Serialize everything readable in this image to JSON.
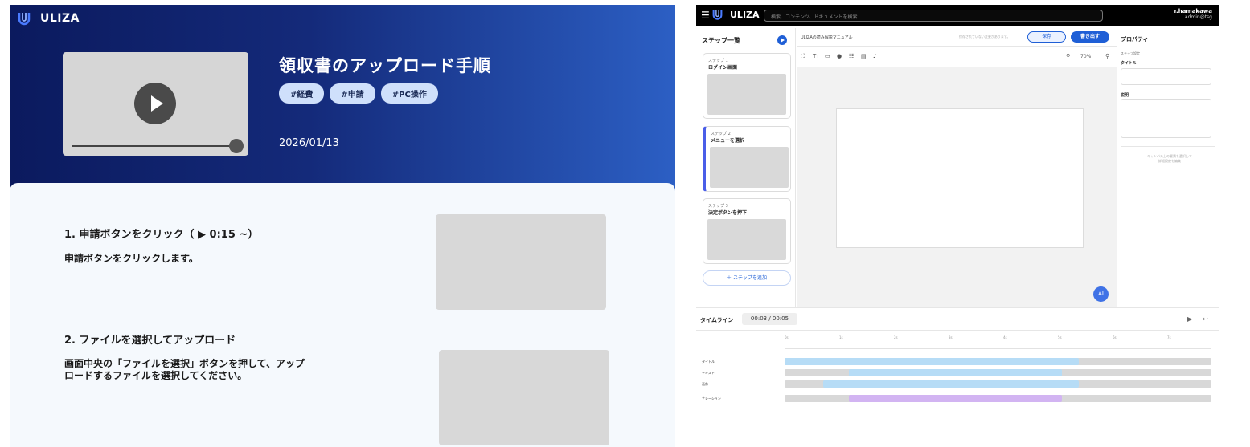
{
  "viewer": {
    "brand": "ULIZA",
    "title": "領収書のアップロード手順",
    "tags": [
      "#経費",
      "#申請",
      "#PC操作"
    ],
    "date": "2026/01/13",
    "steps": [
      {
        "heading": "1. 申請ボタンをクリック（ ▶ 0:15 ~）",
        "body": "申請ボタンをクリックします。"
      },
      {
        "heading": "2. ファイルを選択してアップロード",
        "body_line1": "画面中央の「ファイルを選択」ボタンを押して、アップ",
        "body_line2": "ロードするファイルを選択してください。"
      }
    ]
  },
  "editor": {
    "brand": "ULIZA",
    "search_placeholder": "検索、コンテンツ、ドキュメントを検索",
    "user_name": "r.hamakawa",
    "user_email": "admin@tsg",
    "steps_title": "ステップ一覧",
    "steps": [
      {
        "num": "ステップ 1",
        "title": "ログイン画面"
      },
      {
        "num": "ステップ 2",
        "title": "メニューを選択"
      },
      {
        "num": "ステップ 3",
        "title": "決定ボタンを押下"
      }
    ],
    "add_step": "＋ ステップを追加",
    "doc_name": "ULIZAの読み解説マニュアル",
    "unsaved_note": "保存されていない変更があります。",
    "save_label": "保存",
    "export_label": "書き出す",
    "zoom": "70%",
    "ai_label": "AI",
    "props_title": "プロパティ",
    "props_section": "ステップ設定",
    "props_title_label": "タイトル",
    "props_desc_label": "説明",
    "props_hint_line1": "キャンバス上の要素を選択して",
    "props_hint_line2": "詳細設定を編集",
    "timeline_title": "タイムライン",
    "timeline_time": "00:03 / 00:05",
    "ticks": [
      "0s",
      "1s",
      "2s",
      "3s",
      "4s",
      "5s",
      "6s",
      "7s"
    ],
    "tracks": [
      {
        "label": "タイトル",
        "start": 0.0,
        "end": 0.69,
        "color": "#b6dcf6"
      },
      {
        "label": "テキスト",
        "start": 0.15,
        "end": 0.65,
        "color": "#b6dcf6"
      },
      {
        "label": "画像",
        "start": 0.09,
        "end": 0.69,
        "color": "#b6dcf6"
      },
      {
        "label": "ナレーション",
        "start": 0.15,
        "end": 0.65,
        "color": "#d2b4f2"
      }
    ]
  }
}
